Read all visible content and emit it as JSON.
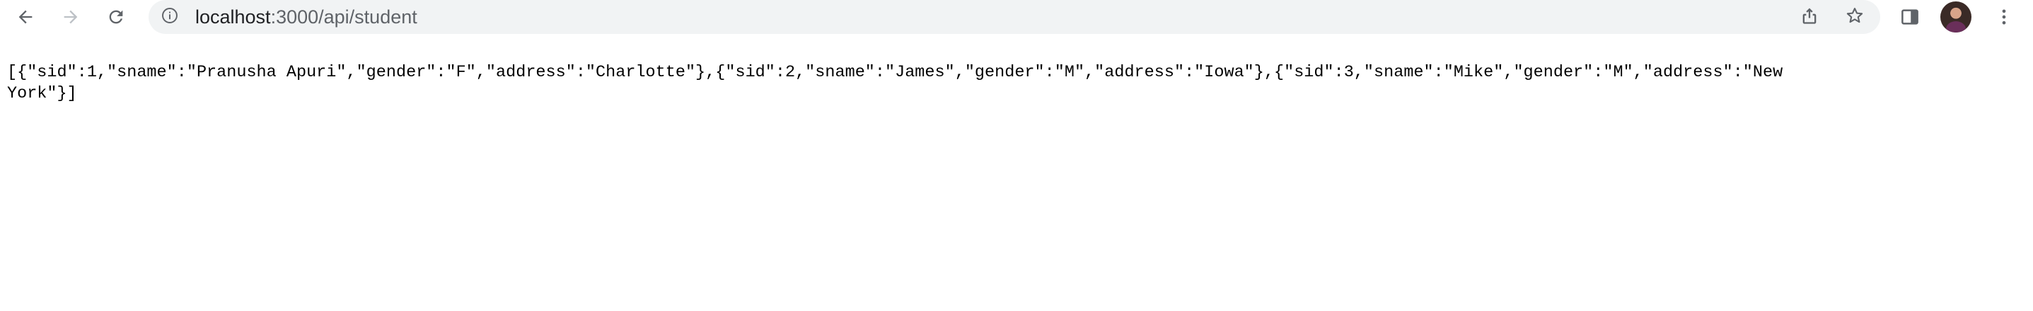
{
  "browser": {
    "address_bar": {
      "host": "localhost",
      "path": ":3000/api/student"
    },
    "icons": {
      "back": "arrow-left-icon",
      "forward": "arrow-right-icon",
      "reload": "reload-icon",
      "site_info": "info-icon",
      "share": "share-icon",
      "bookmark": "star-icon",
      "side_panel": "side-panel-icon",
      "menu": "kebab-menu-icon"
    },
    "colors": {
      "icon_active": "#5f6368",
      "icon_disabled": "#bdc1c6",
      "omnibox_bg": "#f1f3f4"
    }
  },
  "page": {
    "json_lines": [
      "[{\"sid\":1,\"sname\":\"Pranusha Apuri\",\"gender\":\"F\",\"address\":\"Charlotte\"},{\"sid\":2,\"sname\":\"James\",\"gender\":\"M\",\"address\":\"Iowa\"},{\"sid\":3,\"sname\":\"Mike\",\"gender\":\"M\",\"address\":\"New",
      "York\"}]"
    ]
  }
}
